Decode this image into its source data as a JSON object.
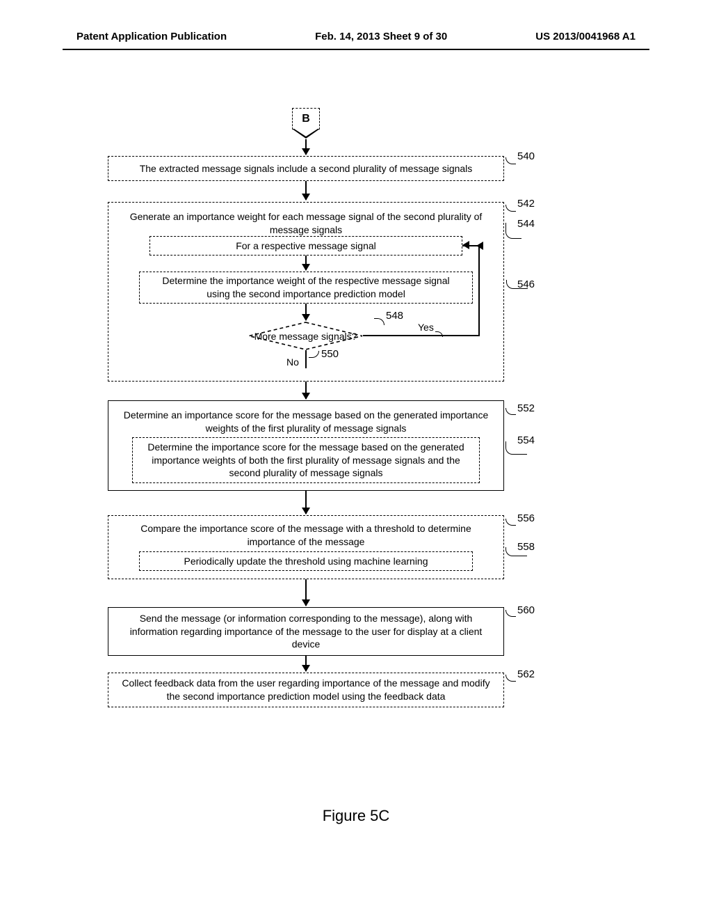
{
  "header": {
    "left": "Patent Application Publication",
    "center": "Feb. 14, 2013  Sheet 9 of 30",
    "right": "US 2013/0041968 A1"
  },
  "figure_label": "Figure 5C",
  "connector_b": "B",
  "boxes": {
    "b540": "The extracted message signals include a second plurality of message signals",
    "b542": "Generate an importance weight for each message signal of the second plurality of message signals",
    "b544": "For a respective message signal",
    "b546": "Determine the importance weight of the respective message signal using the second importance prediction model",
    "decision548": "More message signals?",
    "yes548": "Yes",
    "no550": "No",
    "b552": "Determine an importance score for the message based on the generated importance weights of the first plurality of message signals",
    "b554": "Determine the importance score for the message based on the generated importance weights of both the first plurality of message signals and the second plurality of message signals",
    "b556": "Compare the importance score of the message with a threshold to determine importance of the message",
    "b558": "Periodically update the threshold using machine learning",
    "b560": "Send the message (or information corresponding to the message), along with information regarding importance of the message to the user for display at a client device",
    "b562": "Collect feedback data from the user regarding importance of the message and modify the second importance prediction model using the feedback data"
  },
  "refs": {
    "r540": "540",
    "r542": "542",
    "r544": "544",
    "r546": "546",
    "r548": "548",
    "r550": "550",
    "r552": "552",
    "r554": "554",
    "r556": "556",
    "r558": "558",
    "r560": "560",
    "r562": "562"
  }
}
